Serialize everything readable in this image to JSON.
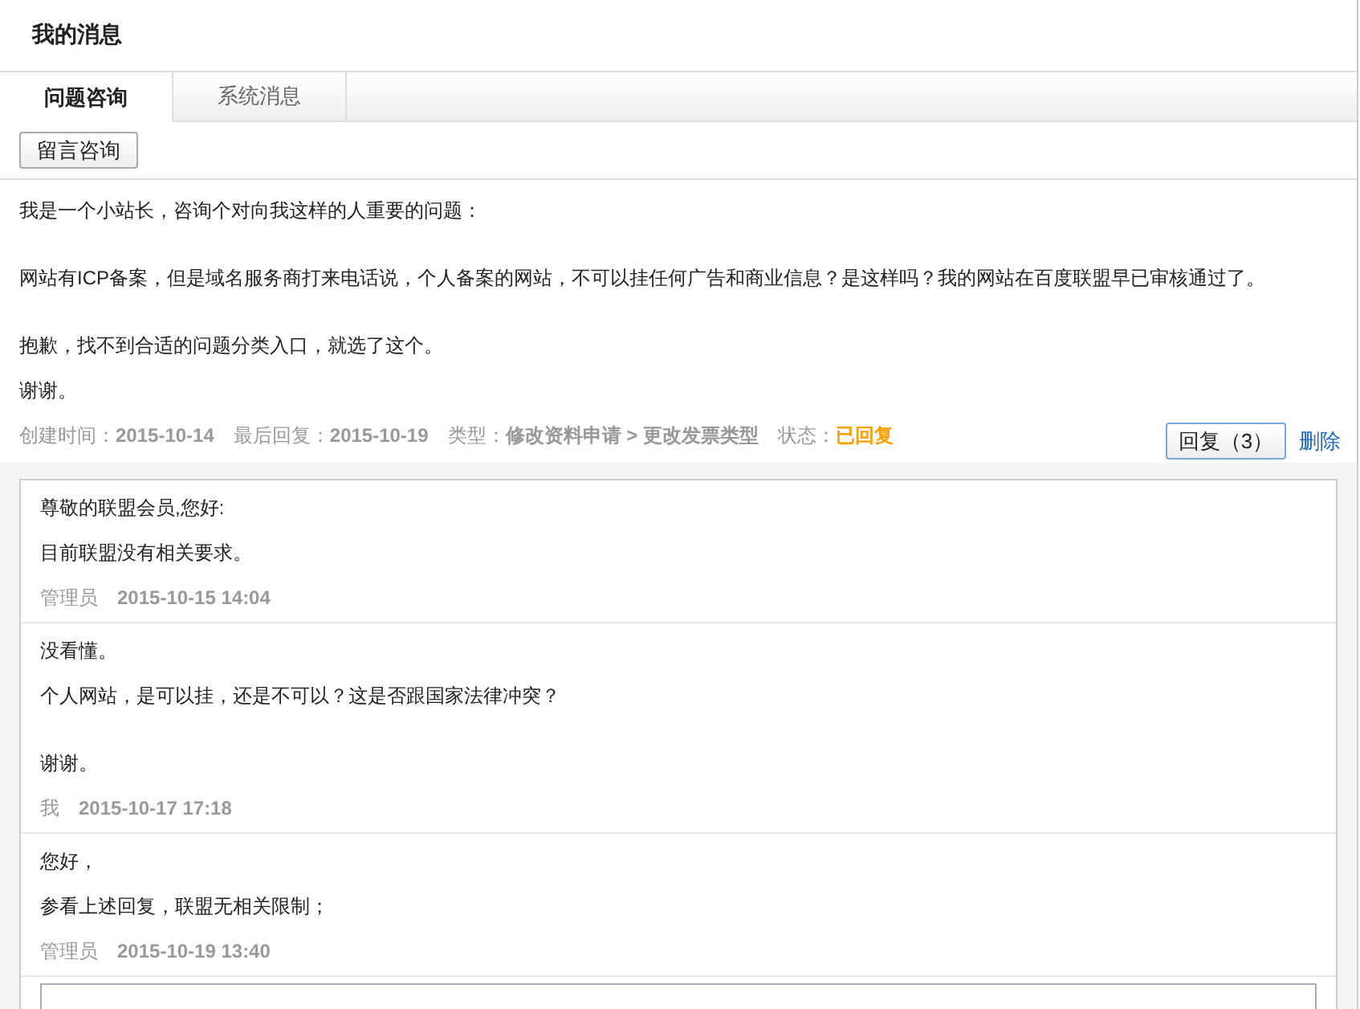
{
  "title": "我的消息",
  "tabs": [
    {
      "label": "问题咨询",
      "selected": true
    },
    {
      "label": "系统消息",
      "selected": false
    }
  ],
  "action_button": "留言咨询",
  "question": {
    "paragraphs": [
      [
        "我是一个小站长，咨询个对向我这样的人重要的问题："
      ],
      [
        "网站有ICP备案，但是域名服务商打来电话说，个人备案的网站，不可以挂任何广告和商业信息？是这样吗？我的网站在百度联盟早已审核通过了。"
      ],
      [
        "抱歉，找不到合适的问题分类入口，就选了这个。",
        "谢谢。"
      ]
    ],
    "meta": [
      {
        "label": "创建时间：",
        "value": "2015-10-14"
      },
      {
        "label": "最后回复：",
        "value": "2015-10-19"
      },
      {
        "label": "类型：",
        "value": "修改资料申请 > 更改发票类型"
      }
    ],
    "status": {
      "label": "状态：",
      "value": "已回复"
    },
    "reply_button": "回复（3）",
    "delete_link": "删除"
  },
  "replies": [
    {
      "paragraphs": [
        [
          "尊敬的联盟会员,您好:",
          "目前联盟没有相关要求。"
        ]
      ],
      "author": "管理员",
      "time": "2015-10-15 14:04"
    },
    {
      "paragraphs": [
        [
          "没看懂。",
          "个人网站，是可以挂，还是不可以？这是否跟国家法律冲突？"
        ],
        [
          "谢谢。"
        ]
      ],
      "author": "我",
      "time": "2015-10-17 17:18"
    },
    {
      "paragraphs": [
        [
          "您好，",
          "参看上述回复，联盟无相关限制；"
        ]
      ],
      "author": "管理员",
      "time": "2015-10-19 13:40"
    }
  ]
}
